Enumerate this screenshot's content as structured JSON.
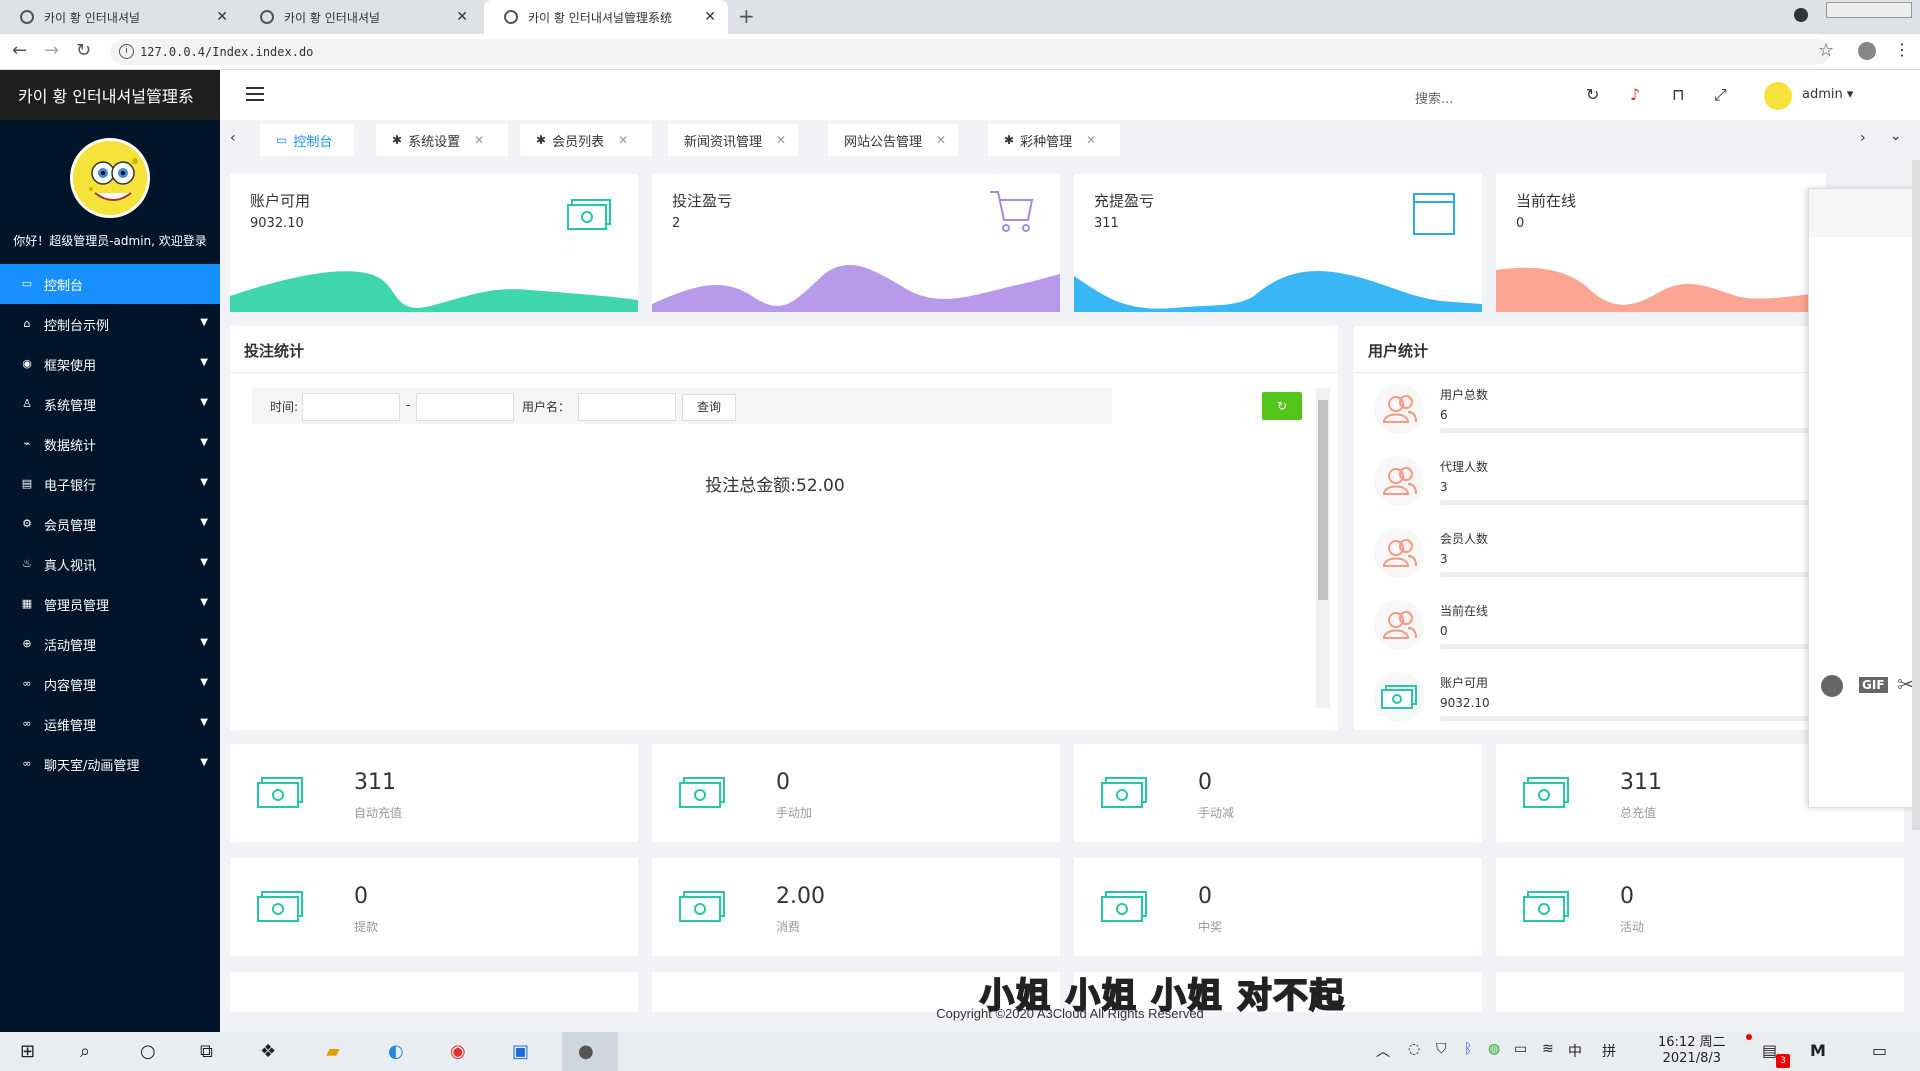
{
  "browser": {
    "tabs": [
      {
        "label": "카이 황 인터내셔널",
        "close": "✕"
      },
      {
        "label": "카이 황 인터내셔널",
        "close": "✕"
      },
      {
        "label": "카이 황 인터내셔널管理系统",
        "close": "✕"
      }
    ],
    "new_tab": "+",
    "url": "127.0.0.4/Index.index.do"
  },
  "sidebar": {
    "brand": "카이 황 인터내셔널管理系",
    "welcome": "你好！超级管理员-admin, 欢迎登录",
    "items": [
      {
        "label": "控制台",
        "icon": "monitor-icon",
        "active": true
      },
      {
        "label": "控制台示例",
        "icon": "home-icon"
      },
      {
        "label": "框架使用",
        "icon": "framework-icon"
      },
      {
        "label": "系统管理",
        "icon": "user-icon"
      },
      {
        "label": "数据统计",
        "icon": "chart-icon"
      },
      {
        "label": "电子银行",
        "icon": "book-icon"
      },
      {
        "label": "会员管理",
        "icon": "gear-icon"
      },
      {
        "label": "真人视讯",
        "icon": "video-icon"
      },
      {
        "label": "管理员管理",
        "icon": "grid-icon"
      },
      {
        "label": "活动管理",
        "icon": "plus-circle-icon"
      },
      {
        "label": "内容管理",
        "icon": "link-icon"
      },
      {
        "label": "运维管理",
        "icon": "link-icon"
      },
      {
        "label": "聊天室/动画管理",
        "icon": "link-icon"
      }
    ]
  },
  "header": {
    "search_placeholder": "搜索...",
    "user": "admin"
  },
  "page_tabs": [
    {
      "label": "控制台",
      "active": true
    },
    {
      "label": "系统设置",
      "close": "✕"
    },
    {
      "label": "会员列表",
      "close": "✕"
    },
    {
      "label": "新闻资讯管理",
      "close": "✕"
    },
    {
      "label": "网站公告管理",
      "close": "✕"
    },
    {
      "label": "彩种管理",
      "close": "✕"
    }
  ],
  "stat_cards": [
    {
      "title": "账户可用",
      "value": "9032.10",
      "color": "#3fd5ae"
    },
    {
      "title": "投注盈亏",
      "value": "2",
      "color": "#b89aeb"
    },
    {
      "title": "充提盈亏",
      "value": "311",
      "color": "#38b6f5"
    },
    {
      "title": "当前在线",
      "value": "0",
      "color": "#fca592"
    }
  ],
  "bet_stats": {
    "title": "投注统计",
    "time_label": "时间:",
    "dash": "-",
    "username_label": "用户名：",
    "query_button": "查询",
    "refresh_icon": "↻",
    "total": "投注总金额:52.00"
  },
  "user_stats": {
    "title": "用户统计",
    "rows": [
      {
        "label": "用户总数",
        "value": "6"
      },
      {
        "label": "代理人数",
        "value": "3"
      },
      {
        "label": "会员人数",
        "value": "3"
      },
      {
        "label": "当前在线",
        "value": "0"
      },
      {
        "label": "账户可用",
        "value": "9032.10"
      }
    ]
  },
  "money_cards": [
    {
      "value": "311",
      "label": "自动充值"
    },
    {
      "value": "0",
      "label": "手动加"
    },
    {
      "value": "0",
      "label": "手动减"
    },
    {
      "value": "311",
      "label": "总充值"
    },
    {
      "value": "0",
      "label": "提款"
    },
    {
      "value": "2.00",
      "label": "消费"
    },
    {
      "value": "0",
      "label": "中奖"
    },
    {
      "value": "0",
      "label": "活动"
    }
  ],
  "footer": "Copyright ©2020 A3Cloud All Rights Reserved",
  "subtitle": "小姐 小姐 小姐 对不起",
  "widget": {
    "gif": "GIF"
  },
  "taskbar": {
    "time": "16:12 周二",
    "date": "2021/8/3",
    "ime1": "中",
    "ime2": "拼",
    "notif_count": "3"
  }
}
